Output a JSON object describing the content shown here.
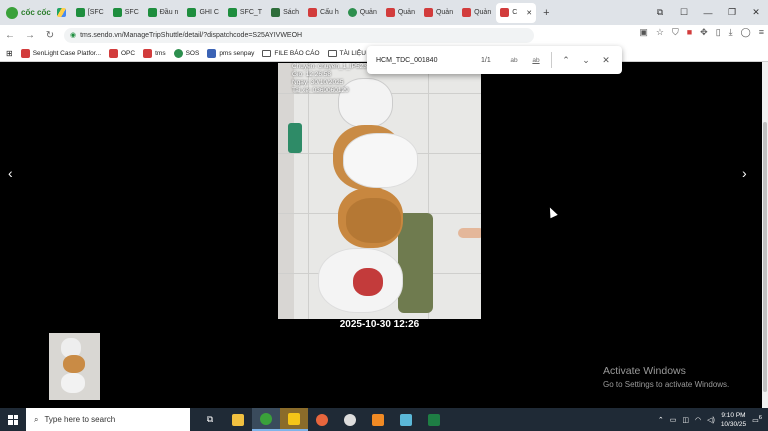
{
  "browser": {
    "brand": "cốc cốc",
    "tabs": [
      {
        "label": "[SFC",
        "icon": "sheet"
      },
      {
        "label": "SFC",
        "icon": "sheet"
      },
      {
        "label": "Đầu n",
        "icon": "sheet"
      },
      {
        "label": "GHI C",
        "icon": "sheet"
      },
      {
        "label": "SFC_T",
        "icon": "sheet"
      },
      {
        "label": "Sách",
        "icon": "book"
      },
      {
        "label": "Cấu h",
        "icon": "red"
      },
      {
        "label": "Quản",
        "icon": "green-circle"
      },
      {
        "label": "Quản",
        "icon": "red"
      },
      {
        "label": "Quản",
        "icon": "red"
      },
      {
        "label": "Quản",
        "icon": "red"
      },
      {
        "label": "C",
        "icon": "red",
        "active": true
      }
    ],
    "url": "tms.sendo.vn/ManageTripShuttle/detail/?dispatchcode=S25AYIVWEOH",
    "bookmarks": [
      "SenLight Case Platfor...",
      "OPC",
      "tms",
      "SOS",
      "pms senpay",
      "FILE BÁO CÁO",
      "TÀI LIỆU"
    ]
  },
  "find": {
    "query": "HCM_TDC_001840",
    "count": "1/1",
    "match_case": "ab",
    "whole_word": "ab"
  },
  "viewer": {
    "overlay_lines": [
      "Chuyen: chuyen_1_IP523",
      "Gio: 12:26:58",
      "Ngay: 30/10/2025",
      "Tai xe: 0369060129"
    ],
    "caption": "2025-10-30 12:26",
    "prev": "‹",
    "next": "›"
  },
  "watermark": {
    "title": "Activate Windows",
    "subtitle": "Go to Settings to activate Windows."
  },
  "taskbar": {
    "search_placeholder": "Type here to search",
    "time": "9:10 PM",
    "date": "10/30/25",
    "notifications": "6"
  }
}
